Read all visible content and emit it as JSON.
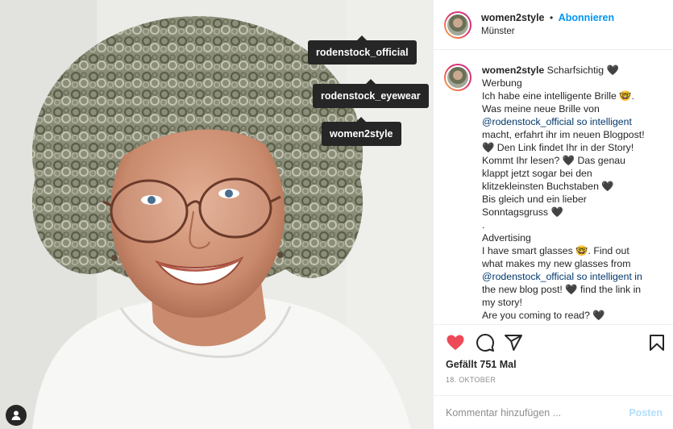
{
  "photo": {
    "tags": [
      "rodenstock_official",
      "rodenstock_eyewear",
      "women2style"
    ]
  },
  "header": {
    "username": "women2style",
    "separator": "•",
    "follow_label": "Abonnieren",
    "location": "Münster"
  },
  "caption": {
    "username": "women2style",
    "lines": [
      "Scharfsichtig 🖤",
      "Werbung",
      "Ich habe eine intelligente Brille 🤓.",
      "Was meine neue Brille von",
      "@rodenstock_official so intelligent",
      "macht, erfahrt ihr im neuen Blogpost!",
      "🖤 Den Link findet Ihr in der Story!",
      "Kommt Ihr lesen? 🖤 Das genau",
      "klappt jetzt sogar bei den",
      "klitzekleinsten Buchstaben 🖤",
      "Bis gleich und ein lieber",
      "Sonntagsgruss 🖤",
      ".",
      "Advertising",
      "I have smart glasses 🤓. Find out",
      "what makes my new glasses from",
      "@rodenstock_official so intelligent in",
      "the new blog post! 🖤 find the link in",
      "my story!",
      "Are you coming to read? 🖤"
    ]
  },
  "actions": {
    "icons": [
      "heart-icon",
      "comment-icon",
      "share-icon",
      "bookmark-icon"
    ],
    "liked": true,
    "likes_text": "Gefällt 751 Mal",
    "date": "18. OKTOBER"
  },
  "comment": {
    "placeholder": "Kommentar hinzufügen ...",
    "post_label": "Posten"
  },
  "colors": {
    "accent": "#0095f6",
    "like": "#ed4956",
    "mention": "#00376b"
  }
}
